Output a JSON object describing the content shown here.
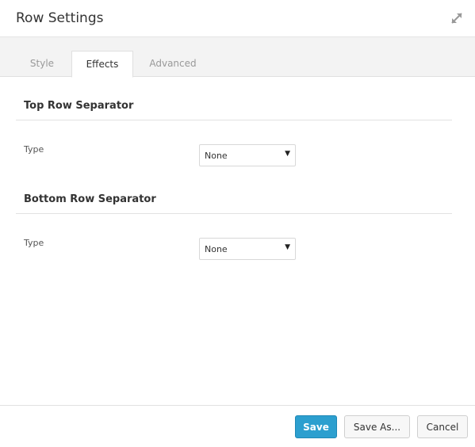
{
  "header": {
    "title": "Row Settings",
    "expand_icon": "expand-arrows-icon"
  },
  "tabs": [
    {
      "label": "Style",
      "active": false
    },
    {
      "label": "Effects",
      "active": true
    },
    {
      "label": "Advanced",
      "active": false
    }
  ],
  "sections": [
    {
      "title": "Top Row Separator",
      "field_label": "Type",
      "select_value": "None"
    },
    {
      "title": "Bottom Row Separator",
      "field_label": "Type",
      "select_value": "None"
    }
  ],
  "footer": {
    "save_label": "Save",
    "save_as_label": "Save As...",
    "cancel_label": "Cancel"
  },
  "colors": {
    "primary": "#2c9fcf"
  }
}
